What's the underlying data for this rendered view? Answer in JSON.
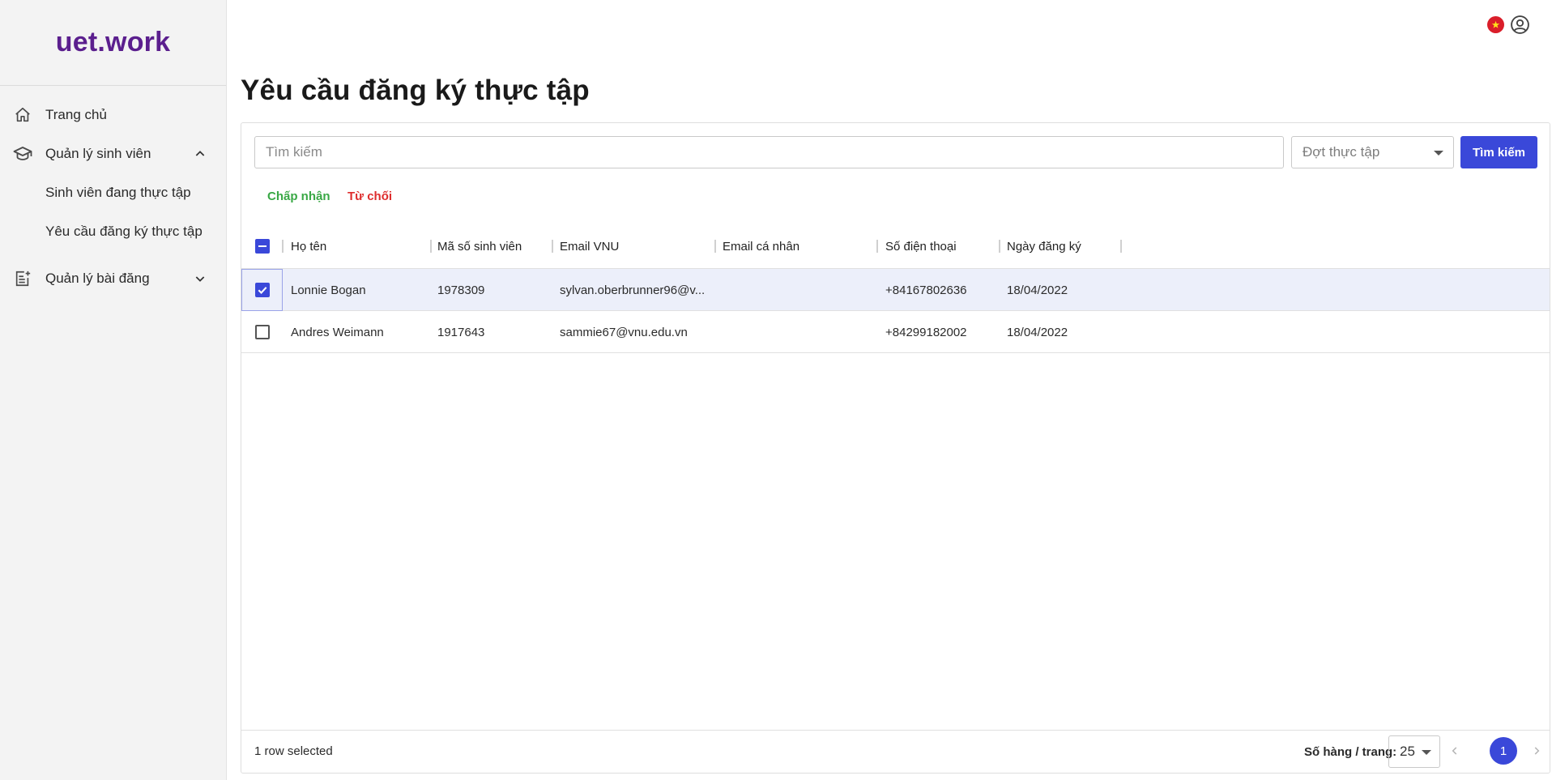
{
  "app": {
    "logo": "uet.work"
  },
  "sidebar": {
    "items": [
      {
        "label": "Trang chủ",
        "icon": "home-icon"
      },
      {
        "label": "Quản lý sinh viên",
        "icon": "graduation-cap-icon",
        "expanded": true
      },
      {
        "label": "Sinh viên đang thực tập"
      },
      {
        "label": "Yêu cầu đăng ký thực tập"
      },
      {
        "label": "Quản lý bài đăng",
        "icon": "post-add-icon",
        "expanded": false
      }
    ]
  },
  "header": {
    "language_icon": "vietnam-flag-icon",
    "account_icon": "user-circle-icon"
  },
  "page": {
    "title": "Yêu cầu đăng ký thực tập"
  },
  "filters": {
    "search_placeholder": "Tìm kiếm",
    "search_value": "",
    "period_placeholder": "Đợt thực tập",
    "search_button": "Tìm kiếm"
  },
  "actions": {
    "accept": "Chấp nhận",
    "reject": "Từ chối"
  },
  "table": {
    "columns": [
      "Họ tên",
      "Mã số sinh viên",
      "Email VNU",
      "Email cá nhân",
      "Số điện thoại",
      "Ngày đăng ký"
    ],
    "rows": [
      {
        "selected": true,
        "name": "Lonnie Bogan",
        "student_id": "1978309",
        "email_vnu": "sylvan.oberbrunner96@v...",
        "email_personal": "",
        "phone": "+84167802636",
        "date": "18/04/2022"
      },
      {
        "selected": false,
        "name": "Andres Weimann",
        "student_id": "1917643",
        "email_vnu": "sammie67@vnu.edu.vn",
        "email_personal": "",
        "phone": "+84299182002",
        "date": "18/04/2022"
      }
    ]
  },
  "footer": {
    "selection_text": "1 row selected",
    "rows_per_page_label": "Số hàng / trang:",
    "rows_per_page": "25",
    "current_page": "1"
  },
  "colors": {
    "brand": "#5b1f8e",
    "primary": "#3a48d9",
    "accept": "#39a845",
    "reject": "#de2d2d"
  }
}
